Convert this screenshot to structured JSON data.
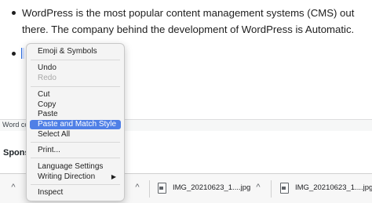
{
  "editor": {
    "paragraph": "WordPress is the most popular content management systems (CMS) out there. The company behind the development of WordPress is Automatic."
  },
  "status": {
    "word_count_partial": "Word co",
    "sponsored_partial": "Spons"
  },
  "context_menu": {
    "emoji": "Emoji & Symbols",
    "undo": "Undo",
    "redo": "Redo",
    "cut": "Cut",
    "copy": "Copy",
    "paste": "Paste",
    "paste_match": "Paste and Match Style",
    "select_all": "Select All",
    "print": "Print...",
    "language_settings": "Language Settings",
    "writing_direction": "Writing Direction",
    "writing_direction_arrow": "▶",
    "inspect": "Inspect",
    "highlight_color": "#4f7fe6"
  },
  "download_shelf": {
    "chevron": "^",
    "items": [
      {
        "name": "IMG_20210623_1....jpg",
        "icon": "file-icon"
      },
      {
        "name": "IMG_20210623_1....jpg",
        "icon": "file-icon"
      }
    ]
  }
}
